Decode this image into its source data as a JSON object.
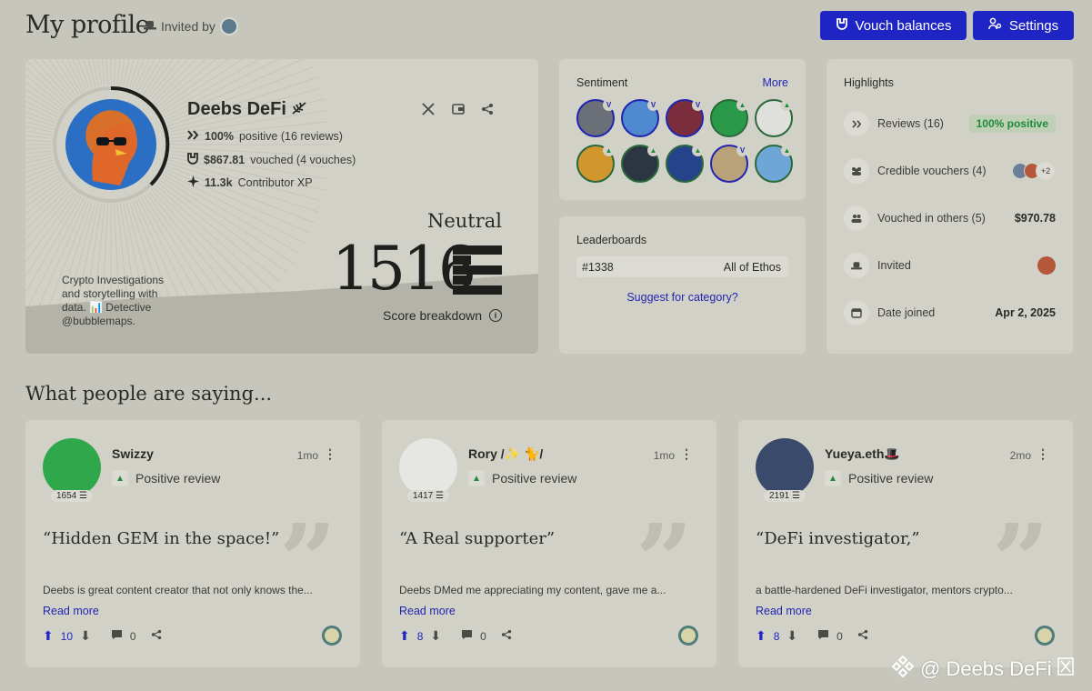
{
  "header": {
    "title": "My profile",
    "invited_by": "Invited by",
    "vouch_balances": "Vouch balances",
    "settings": "Settings"
  },
  "profile": {
    "name": "Deebs DeFi",
    "positive_pct": "100%",
    "positive_rest": "positive (16 reviews)",
    "vouched_amount": "$867.81",
    "vouched_rest": "vouched (4 vouches)",
    "xp_amount": "11.3k",
    "xp_rest": "Contributor XP",
    "bio": "Crypto Investigations and storytelling with data. 📊 Detective @bubblemaps.",
    "level": "Neutral",
    "score": "1516",
    "score_breakdown": "Score breakdown"
  },
  "sentiment": {
    "label": "Sentiment",
    "more": "More",
    "avatars": [
      {
        "color": "#6b6f78",
        "badge": "v"
      },
      {
        "color": "#4f8ad0",
        "badge": "v"
      },
      {
        "color": "#7a2d3d",
        "badge": "v"
      },
      {
        "color": "#2a9a4a",
        "badge": "up"
      },
      {
        "color": "#dfe0dc",
        "badge": "up"
      },
      {
        "color": "#d2962e",
        "badge": "up"
      },
      {
        "color": "#2b3642",
        "badge": "up"
      },
      {
        "color": "#25428a",
        "badge": "up"
      },
      {
        "color": "#b9a27a",
        "badge": "v"
      },
      {
        "color": "#6fa6d8",
        "badge": "up"
      }
    ]
  },
  "leaderboards": {
    "label": "Leaderboards",
    "rank": "#1338",
    "category": "All of Ethos",
    "suggest": "Suggest for category?"
  },
  "highlights": {
    "label": "Highlights",
    "reviews": "Reviews (16)",
    "reviews_badge": "100% positive",
    "credible": "Credible vouchers (4)",
    "credible_more": "+2",
    "vouched_others": "Vouched in others (5)",
    "vouched_others_value": "$970.78",
    "invited": "Invited",
    "date_joined": "Date joined",
    "date_joined_value": "Apr 2, 2025"
  },
  "section_title": "What people are saying...",
  "reviews": [
    {
      "name": "Swizzy",
      "time": "1mo",
      "score": "1654",
      "sentiment": "Positive review",
      "quote": "“Hidden GEM in the space!”",
      "text": "Deebs is great content creator that not only knows the...",
      "read_more": "Read more",
      "upvotes": "10",
      "comments": "0",
      "avatar_color": "#2ea84a"
    },
    {
      "name": "Rory /✨ 🐈/",
      "time": "1mo",
      "score": "1417",
      "sentiment": "Positive review",
      "quote": "“A Real supporter”",
      "text": "Deebs DMed me appreciating my content, gave me a...",
      "read_more": "Read more",
      "upvotes": "8",
      "comments": "0",
      "avatar_color": "#e6e6e2"
    },
    {
      "name": "Yueya.eth🎩",
      "time": "2mo",
      "score": "2191",
      "sentiment": "Positive review",
      "quote": "“DeFi investigator,”",
      "text": "a battle-hardened DeFi investigator, mentors crypto...",
      "read_more": "Read more",
      "upvotes": "8",
      "comments": "0",
      "avatar_color": "#3a4a6a"
    }
  ],
  "watermark": "@ Deebs DeFi"
}
